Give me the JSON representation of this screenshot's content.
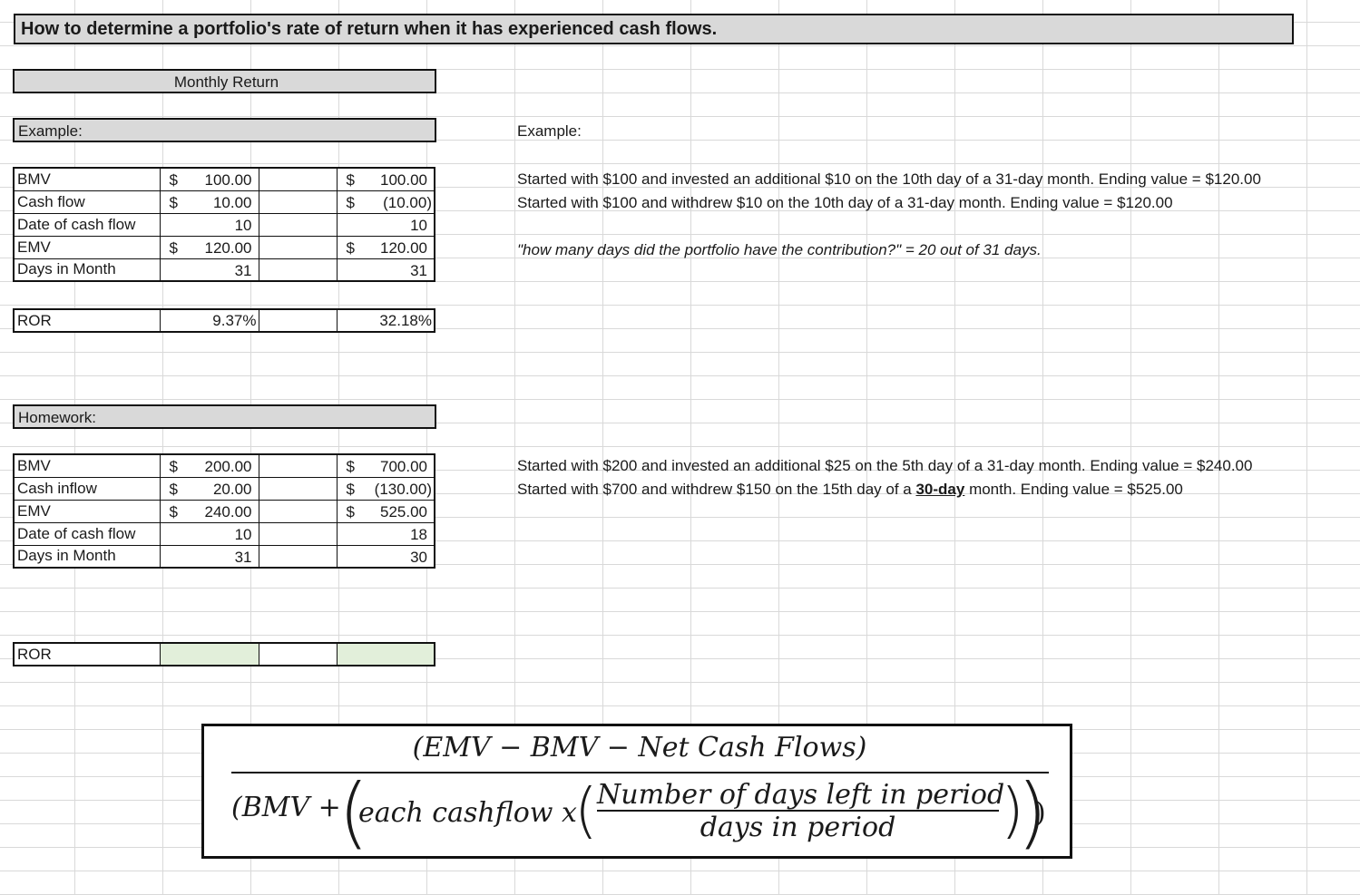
{
  "title": "How to determine a portfolio's rate of return when it has experienced cash flows.",
  "monthly_return_label": "Monthly Return",
  "example": {
    "section_label": "Example:",
    "rows": [
      {
        "label": "BMV",
        "col1_dollar": "$",
        "col1": "100.00",
        "col2_dollar": "$",
        "col2": "100.00"
      },
      {
        "label": "Cash flow",
        "col1_dollar": "$",
        "col1": "10.00",
        "col2_dollar": "$",
        "col2": "(10.00)"
      },
      {
        "label": "Date of cash flow",
        "col1_dollar": "",
        "col1": "10",
        "col2_dollar": "",
        "col2": "10"
      },
      {
        "label": "EMV",
        "col1_dollar": "$",
        "col1": "120.00",
        "col2_dollar": "$",
        "col2": "120.00"
      },
      {
        "label": "Days in Month",
        "col1_dollar": "",
        "col1": "31",
        "col2_dollar": "",
        "col2": "31"
      }
    ],
    "ror": {
      "label": "ROR",
      "col1": "9.37%",
      "col2": "32.18%"
    },
    "notes_header": "Example:",
    "note1": "Started with $100 and invested an additional $10 on the 10th day of a 31-day month. Ending value = $120.00",
    "note2": "Started with $100 and withdrew $10 on the 10th day of a 31-day month. Ending value = $120.00",
    "note3": "\"how many days did the portfolio have the contribution?\" = 20 out of 31 days."
  },
  "homework": {
    "section_label": "Homework:",
    "rows": [
      {
        "label": "BMV",
        "col1_dollar": "$",
        "col1": "200.00",
        "col2_dollar": "$",
        "col2": "700.00"
      },
      {
        "label": "Cash inflow",
        "col1_dollar": "$",
        "col1": "20.00",
        "col2_dollar": "$",
        "col2": "(130.00)"
      },
      {
        "label": "EMV",
        "col1_dollar": "$",
        "col1": "240.00",
        "col2_dollar": "$",
        "col2": "525.00"
      },
      {
        "label": "Date of cash flow",
        "col1_dollar": "",
        "col1": "10",
        "col2_dollar": "",
        "col2": "18"
      },
      {
        "label": "Days in Month",
        "col1_dollar": "",
        "col1": "31",
        "col2_dollar": "",
        "col2": "30"
      }
    ],
    "ror": {
      "label": "ROR",
      "col1": "",
      "col2": ""
    },
    "note1": "Started with $200 and invested an additional $25 on the 5th day of a 31-day month. Ending value = $240.00",
    "note2_before": "Started with $700 and withdrew $150 on the 15th day of a ",
    "note2_emph": "30-day",
    "note2_after": " month. Ending value = $525.00",
    "ror_fill_color": "#e2efda"
  },
  "formula": {
    "numerator": "(EMV  − BMV  −  Net Cash Flows)",
    "denominator_left": "(BMV + ",
    "denominator_mid": "each cashflow x",
    "inner_numerator": "Number of days left in period",
    "inner_denominator": "days in period"
  }
}
